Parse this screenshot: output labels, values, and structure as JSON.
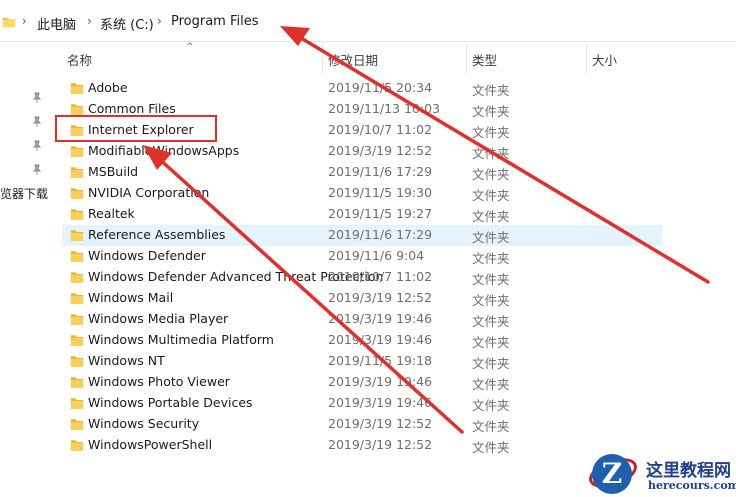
{
  "breadcrumb": {
    "items": [
      "此电脑",
      "系统 (C:)",
      "Program Files"
    ]
  },
  "columns": {
    "name": "名称",
    "date": "修改日期",
    "type": "类型",
    "size": "大小"
  },
  "nav": {
    "label": "览器下载",
    "pins": [
      "pin-icon",
      "pin-icon",
      "pin-icon",
      "pin-icon"
    ]
  },
  "files": [
    {
      "name": "Adobe",
      "date": "2019/11/5 20:34",
      "type": "文件夹"
    },
    {
      "name": "Common Files",
      "date": "2019/11/13 10:03",
      "type": "文件夹"
    },
    {
      "name": "Internet Explorer",
      "date": "2019/10/7 11:02",
      "type": "文件夹"
    },
    {
      "name": "ModifiableWindowsApps",
      "date": "2019/3/19 12:52",
      "type": "文件夹"
    },
    {
      "name": "MSBuild",
      "date": "2019/11/6 17:29",
      "type": "文件夹"
    },
    {
      "name": "NVIDIA Corporation",
      "date": "2019/11/5 19:30",
      "type": "文件夹"
    },
    {
      "name": "Realtek",
      "date": "2019/11/5 19:27",
      "type": "文件夹"
    },
    {
      "name": "Reference Assemblies",
      "date": "2019/11/6 17:29",
      "type": "文件夹"
    },
    {
      "name": "Windows Defender",
      "date": "2019/11/6 9:04",
      "type": "文件夹"
    },
    {
      "name": "Windows Defender Advanced Threat Protection",
      "date": "2019/10/7 11:02",
      "type": "文件夹"
    },
    {
      "name": "Windows Mail",
      "date": "2019/3/19 12:52",
      "type": "文件夹"
    },
    {
      "name": "Windows Media Player",
      "date": "2019/3/19 19:46",
      "type": "文件夹"
    },
    {
      "name": "Windows Multimedia Platform",
      "date": "2019/3/19 19:46",
      "type": "文件夹"
    },
    {
      "name": "Windows NT",
      "date": "2019/11/5 19:18",
      "type": "文件夹"
    },
    {
      "name": "Windows Photo Viewer",
      "date": "2019/3/19 19:46",
      "type": "文件夹"
    },
    {
      "name": "Windows Portable Devices",
      "date": "2019/3/19 19:46",
      "type": "文件夹"
    },
    {
      "name": "Windows Security",
      "date": "2019/3/19 12:52",
      "type": "文件夹"
    },
    {
      "name": "WindowsPowerShell",
      "date": "2019/3/19 12:52",
      "type": "文件夹"
    }
  ],
  "selected_row": "Reference Assemblies",
  "highlighted_row": "Internet Explorer",
  "watermark": {
    "logo_letter": "Z",
    "title": "这里教程网",
    "url": "herecours.com"
  },
  "colors": {
    "annotation": "#e0302a",
    "selection": "#e5f3ff",
    "folder": "#f5c84c"
  }
}
